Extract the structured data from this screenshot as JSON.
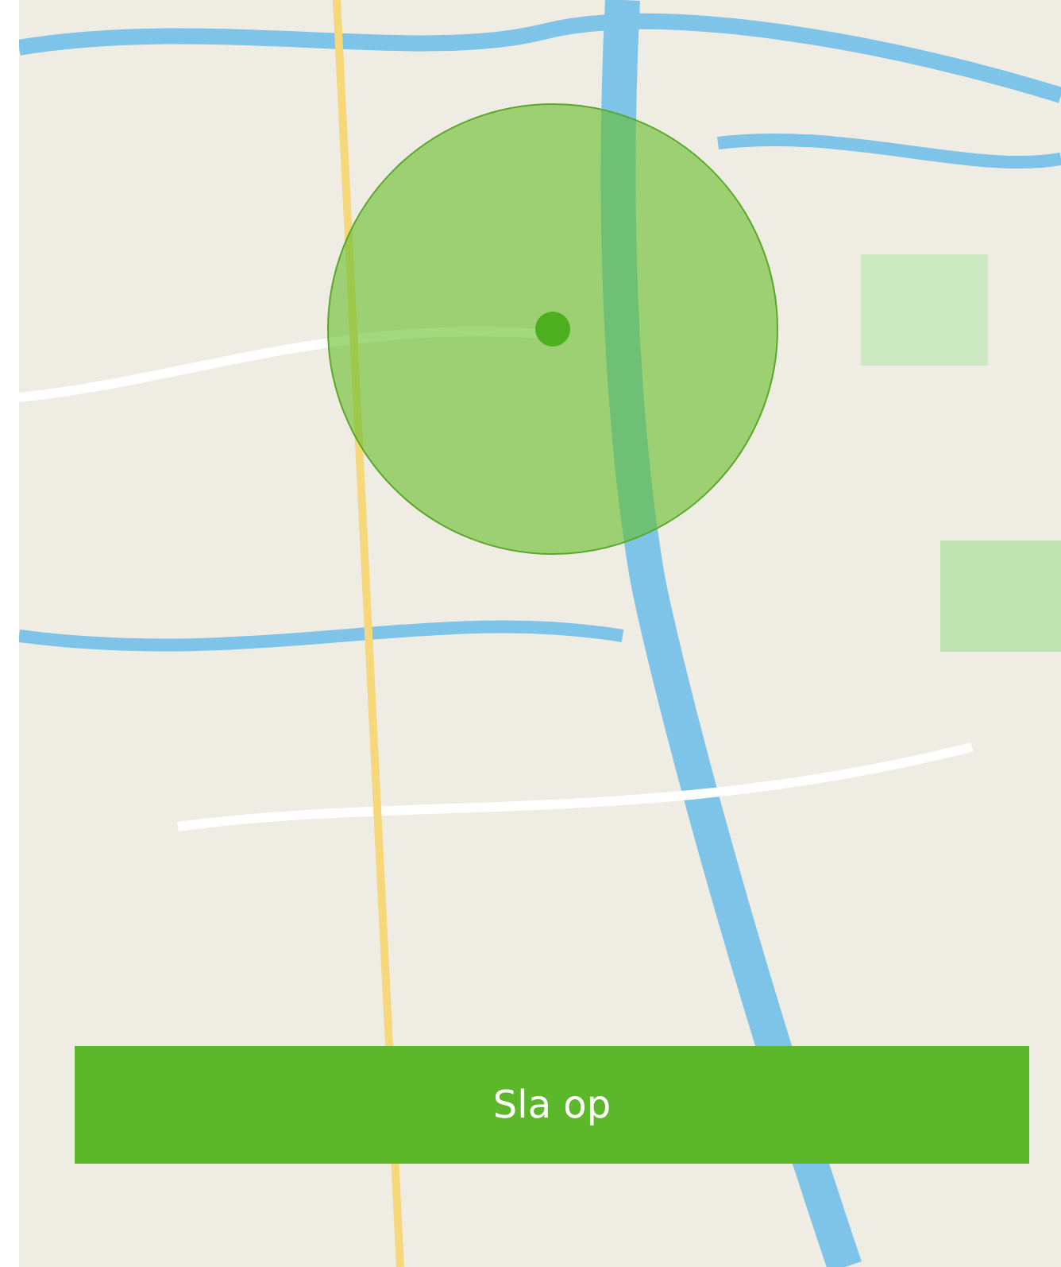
{
  "save_button": {
    "label": "Sla op"
  }
}
